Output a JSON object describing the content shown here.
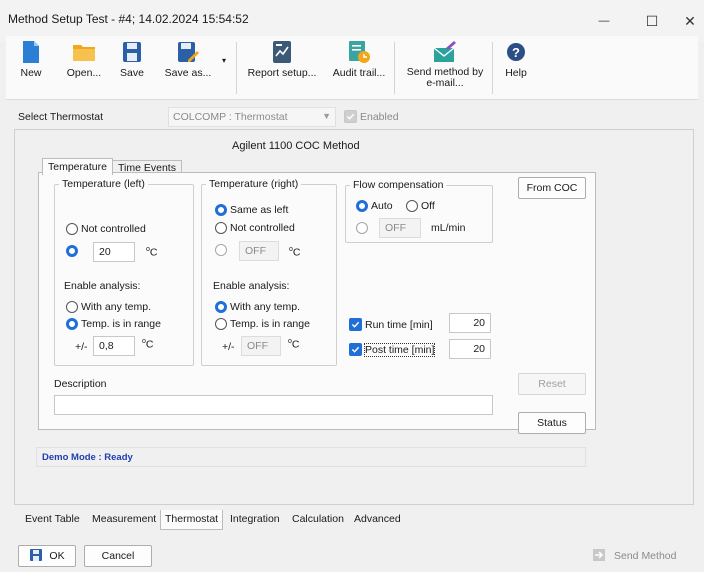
{
  "window": {
    "title": "Method Setup Test - #4;  14.02.2024  15:54:52",
    "minimize": "—",
    "maximize": "☐",
    "close": "✕"
  },
  "toolbar": {
    "new": "New",
    "open": "Open...",
    "save": "Save",
    "save_as": "Save as...",
    "report_setup": "Report setup...",
    "audit_trail": "Audit trail...",
    "send_method_line1": "Send method by",
    "send_method_line2": "e-mail...",
    "help": "Help"
  },
  "thermostat_select": {
    "label": "Select Thermostat",
    "value": "COLCOMP : Thermostat",
    "enabled_label": "Enabled"
  },
  "method_title": "Agilent 1100 COC Method",
  "tabs": {
    "temperature": "Temperature",
    "time_events": "Time Events"
  },
  "temp_left": {
    "legend": "Temperature (left)",
    "not_controlled": "Not controlled",
    "value": "20",
    "unit_deg": "o",
    "unit_c": "C",
    "enable_analysis": "Enable analysis:",
    "with_any_temp": "With any temp.",
    "temp_in_range": "Temp. is in range",
    "plusminus": "+/-",
    "range_value": "0,8"
  },
  "temp_right": {
    "legend": "Temperature (right)",
    "same_as_left": "Same as left",
    "not_controlled": "Not controlled",
    "value": "OFF",
    "enable_analysis": "Enable analysis:",
    "with_any_temp": "With any temp.",
    "temp_in_range": "Temp. is in range",
    "plusminus": "+/-",
    "range_value": "OFF"
  },
  "flow": {
    "legend": "Flow compensation",
    "auto": "Auto",
    "off": "Off",
    "value": "OFF",
    "unit": "mL/min"
  },
  "run_time": {
    "label": "Run time [min]",
    "value": "20"
  },
  "post_time": {
    "label": "Post time [min]",
    "value": "20"
  },
  "buttons": {
    "from_coc": "From COC",
    "reset": "Reset",
    "status": "Status"
  },
  "description": {
    "label": "Description",
    "value": ""
  },
  "status_text": "Demo Mode : Ready",
  "bottom_tabs": [
    "Event Table",
    "Measurement",
    "Thermostat",
    "Integration",
    "Calculation",
    "Advanced"
  ],
  "footer": {
    "ok": "OK",
    "cancel": "Cancel",
    "send_method": "Send Method"
  },
  "colors": {
    "accent": "#1f6fd6",
    "status_text": "#1f3fb0"
  }
}
